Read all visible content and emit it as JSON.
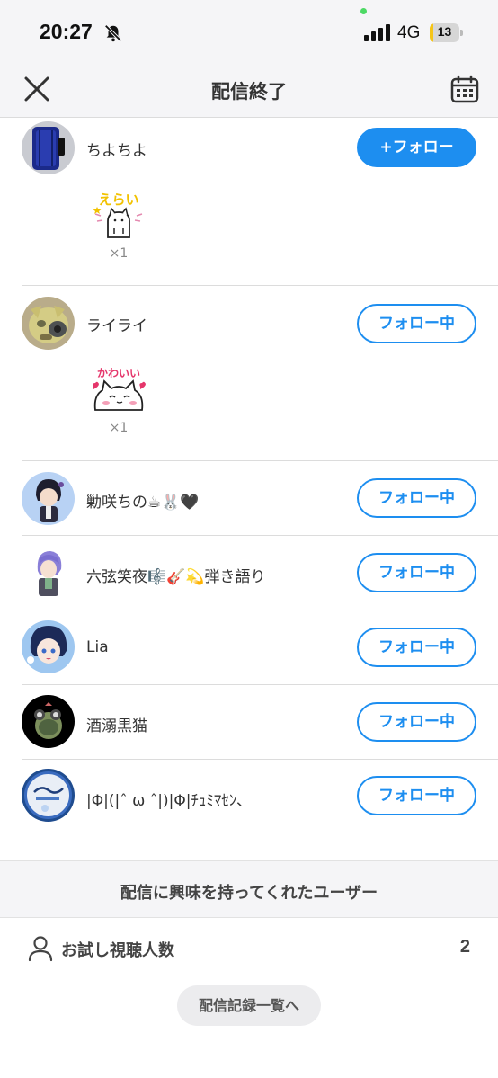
{
  "status_bar": {
    "time": "20:27",
    "network": "4G",
    "battery": "13",
    "battery_level": 0.13
  },
  "header": {
    "title": "配信終了"
  },
  "users": [
    {
      "name": "ちよちよ",
      "button": "+フォロー",
      "gift_count": "×1"
    },
    {
      "name": "ライライ",
      "button": "フォロー中",
      "gift_count": "×1"
    },
    {
      "name": "勦咲ちの☕🐰🖤",
      "button": "フォロー中"
    },
    {
      "name": "六弦笑夜🎼🎸💫弾き語り",
      "button": "フォロー中"
    },
    {
      "name": "Lia",
      "button": "フォロー中"
    },
    {
      "name": "酒溺黒猫",
      "button": "フォロー中"
    },
    {
      "name": "|Φ|(|ˆ ω ˆ|)|Φ|ﾁｭﾐﾏｾﾝ､",
      "button": "フォロー中"
    }
  ],
  "gifts": {
    "erai_text": "えらい",
    "kawaii_text": "かわいい"
  },
  "interested_users_label": "配信に興味を持ってくれたユーザー",
  "trial_viewers": {
    "label": "お試し視聴人数",
    "count": "2"
  },
  "history_button": "配信記録一覧へ",
  "colors": {
    "accent": "#1d8ef0",
    "background_gray": "#f5f5f7",
    "battery_yellow": "#f5c518"
  }
}
